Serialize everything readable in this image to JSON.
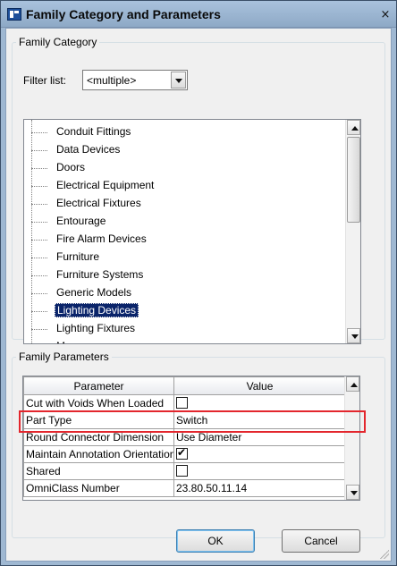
{
  "window": {
    "title": "Family Category and Parameters",
    "close_glyph": "×",
    "icon": "revit-app-icon"
  },
  "family_category": {
    "legend": "Family Category",
    "filter_label": "Filter list:",
    "filter_value": "<multiple>",
    "items": [
      {
        "label": "Conduit Fittings",
        "selected": false
      },
      {
        "label": "Data Devices",
        "selected": false
      },
      {
        "label": "Doors",
        "selected": false
      },
      {
        "label": "Electrical Equipment",
        "selected": false
      },
      {
        "label": "Electrical Fixtures",
        "selected": false
      },
      {
        "label": "Entourage",
        "selected": false
      },
      {
        "label": "Fire Alarm Devices",
        "selected": false
      },
      {
        "label": "Furniture",
        "selected": false
      },
      {
        "label": "Furniture Systems",
        "selected": false
      },
      {
        "label": "Generic Models",
        "selected": false
      },
      {
        "label": "Lighting Devices",
        "selected": true
      },
      {
        "label": "Lighting Fixtures",
        "selected": false
      },
      {
        "label": "M",
        "selected": false
      }
    ]
  },
  "family_parameters": {
    "legend": "Family Parameters",
    "columns": [
      "Parameter",
      "Value"
    ],
    "rows": [
      {
        "parameter": "Cut with Voids When Loaded",
        "value": "",
        "checkbox": "unchecked"
      },
      {
        "parameter": "Part Type",
        "value": "Switch",
        "checkbox": null
      },
      {
        "parameter": "Round Connector Dimension",
        "value": "Use Diameter",
        "checkbox": null
      },
      {
        "parameter": "Maintain Annotation Orientation",
        "value": "",
        "checkbox": "checked"
      },
      {
        "parameter": "Shared",
        "value": "",
        "checkbox": "unchecked"
      },
      {
        "parameter": "OmniClass Number",
        "value": "23.80.50.11.14",
        "checkbox": null
      }
    ]
  },
  "buttons": {
    "ok": "OK",
    "cancel": "Cancel"
  },
  "colors": {
    "selection": "#0a246a",
    "highlight_box": "#e3262d",
    "title_bar": "#9fb8d2"
  }
}
